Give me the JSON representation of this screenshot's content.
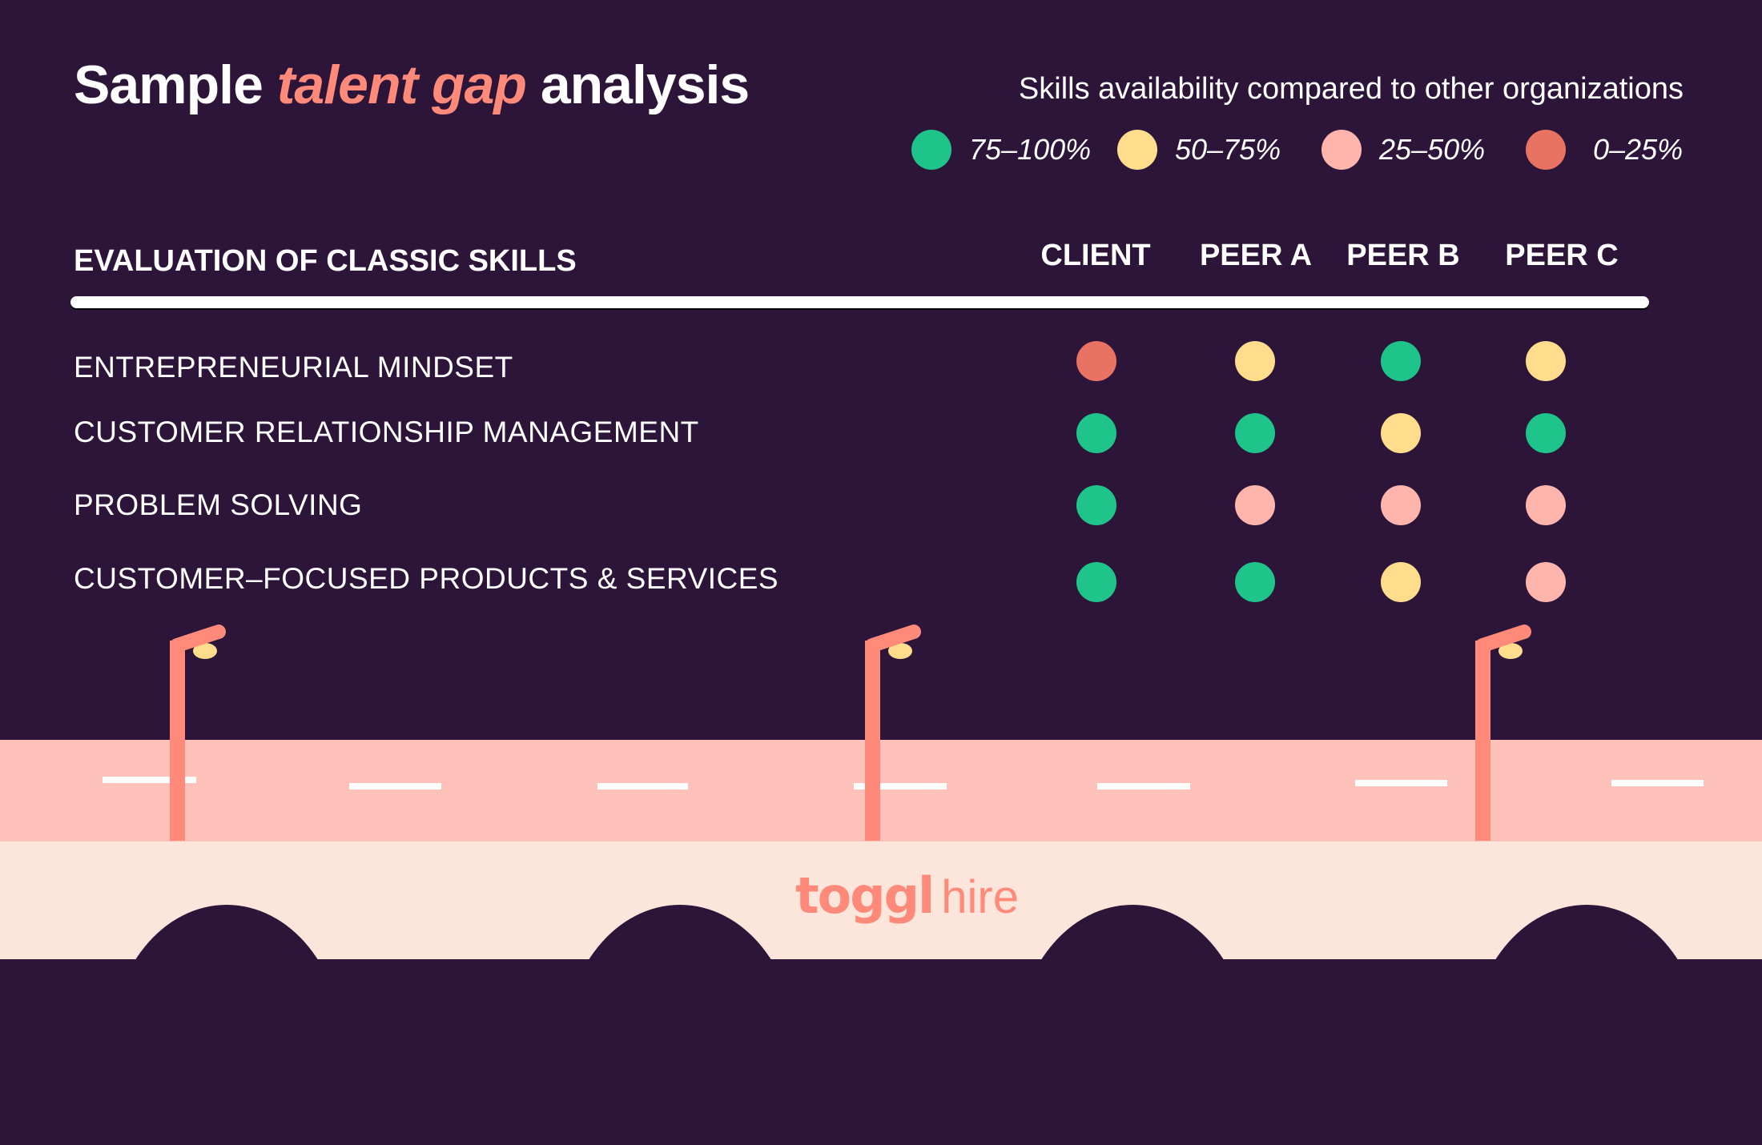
{
  "title": {
    "prefix": "Sample ",
    "accent": "talent gap",
    "suffix": " analysis"
  },
  "legend": {
    "title": "Skills availability compared to other organizations",
    "items": [
      {
        "key": "high",
        "label": "75–100%",
        "color": "#1fc48a"
      },
      {
        "key": "mid-high",
        "label": "50–75%",
        "color": "#ffdd8c"
      },
      {
        "key": "mid-low",
        "label": "25–50%",
        "color": "#ffb5ac"
      },
      {
        "key": "low",
        "label": "0–25%",
        "color": "#e87363"
      }
    ]
  },
  "table": {
    "heading": "EVALUATION OF CLASSIC SKILLS",
    "columns": [
      "CLIENT",
      "PEER A",
      "PEER B",
      "PEER C"
    ],
    "rows": [
      {
        "skill": "ENTREPRENEURIAL MINDSET",
        "ratings": [
          "low",
          "mid-high",
          "high",
          "mid-high"
        ]
      },
      {
        "skill": "CUSTOMER RELATIONSHIP MANAGEMENT",
        "ratings": [
          "high",
          "high",
          "mid-high",
          "high"
        ]
      },
      {
        "skill": "PROBLEM SOLVING",
        "ratings": [
          "high",
          "mid-low",
          "mid-low",
          "mid-low"
        ]
      },
      {
        "skill": "CUSTOMER–FOCUSED PRODUCTS & SERVICES",
        "ratings": [
          "high",
          "high",
          "mid-high",
          "mid-low"
        ]
      }
    ]
  },
  "footer": {
    "logo_brand": "toggl",
    "logo_product": "hire"
  },
  "colors": {
    "background": "#2c1538",
    "accent": "#ff8a7a",
    "road": "#ffc2ba",
    "ground": "#fce6dc",
    "lamp": "#ff8a7a",
    "bulb": "#ffdd8c"
  }
}
